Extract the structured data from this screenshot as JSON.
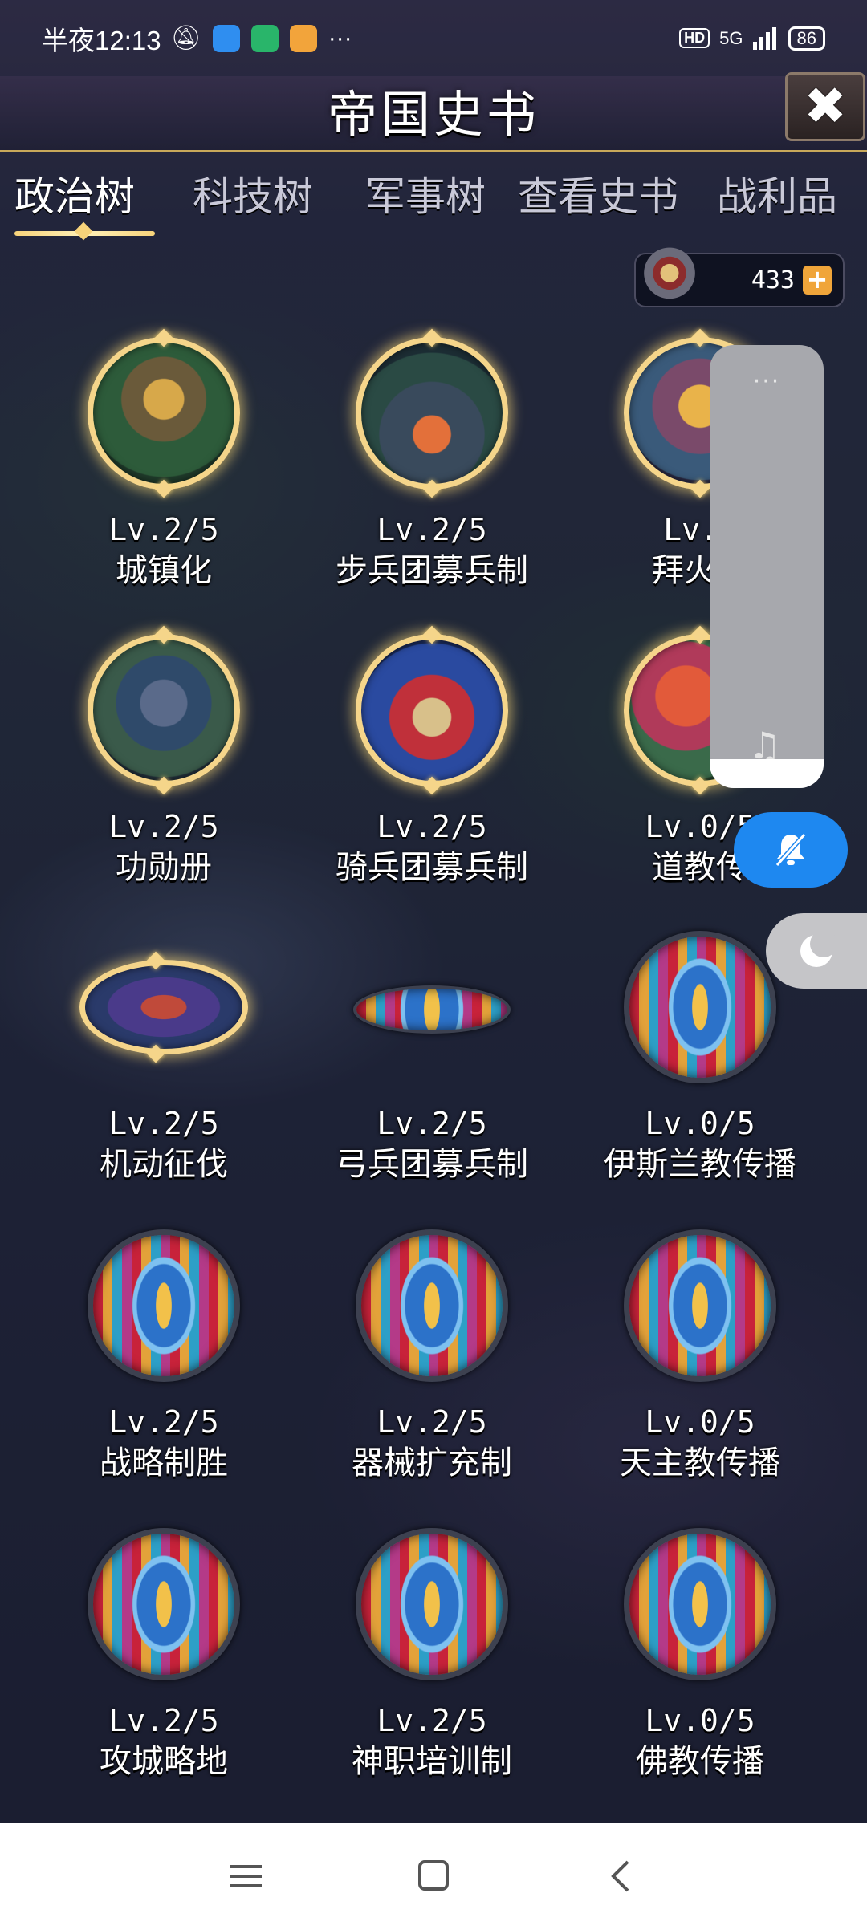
{
  "status_bar": {
    "time": "半夜12:13",
    "network": "5G",
    "hd": "HD",
    "battery": "86",
    "more": "···"
  },
  "header": {
    "title": "帝国史书",
    "close_icon": "close-icon"
  },
  "tabs": [
    {
      "label": "政治树",
      "active": true
    },
    {
      "label": "科技树",
      "active": false
    },
    {
      "label": "军事树",
      "active": false
    },
    {
      "label": "查看史书",
      "active": false
    },
    {
      "label": "战利品",
      "active": false
    }
  ],
  "currency": {
    "value": "433",
    "plus": "+"
  },
  "nodes": [
    {
      "level": "Lv.2/5",
      "name": "城镇化",
      "state": "unlocked"
    },
    {
      "level": "Lv.2/5",
      "name": "步兵团募兵制",
      "state": "unlocked"
    },
    {
      "level": "Lv.2",
      "name": "拜火教",
      "state": "unlocked"
    },
    {
      "level": "Lv.2/5",
      "name": "功勋册",
      "state": "unlocked"
    },
    {
      "level": "Lv.2/5",
      "name": "骑兵团募兵制",
      "state": "unlocked"
    },
    {
      "level": "Lv.0/5",
      "name": "道教传",
      "state": "unlocked"
    },
    {
      "level": "Lv.2/5",
      "name": "机动征伐",
      "state": "unlocked"
    },
    {
      "level": "Lv.2/5",
      "name": "弓兵团募兵制",
      "state": "unlocked"
    },
    {
      "level": "Lv.0/5",
      "name": "伊斯兰教传播",
      "state": "locked"
    },
    {
      "level": "Lv.2/5",
      "name": "战略制胜",
      "state": "locked"
    },
    {
      "level": "Lv.2/5",
      "name": "器械扩充制",
      "state": "locked"
    },
    {
      "level": "Lv.0/5",
      "name": "天主教传播",
      "state": "locked"
    },
    {
      "level": "Lv.2/5",
      "name": "攻城略地",
      "state": "locked"
    },
    {
      "level": "Lv.2/5",
      "name": "神职培训制",
      "state": "locked"
    },
    {
      "level": "Lv.0/5",
      "name": "佛教传播",
      "state": "locked"
    }
  ],
  "overlay": {
    "dots": "···",
    "music_icon": "music-note-icon",
    "mute_icon": "bell-off-icon",
    "moon_icon": "moon-icon"
  },
  "navigation": {
    "menu_icon": "menu-icon",
    "home_icon": "home-icon",
    "back_icon": "back-icon"
  },
  "colors": {
    "gold": "#f5d58a",
    "mute_blue": "#1e88f0",
    "currency_plus": "#f0a53a"
  }
}
